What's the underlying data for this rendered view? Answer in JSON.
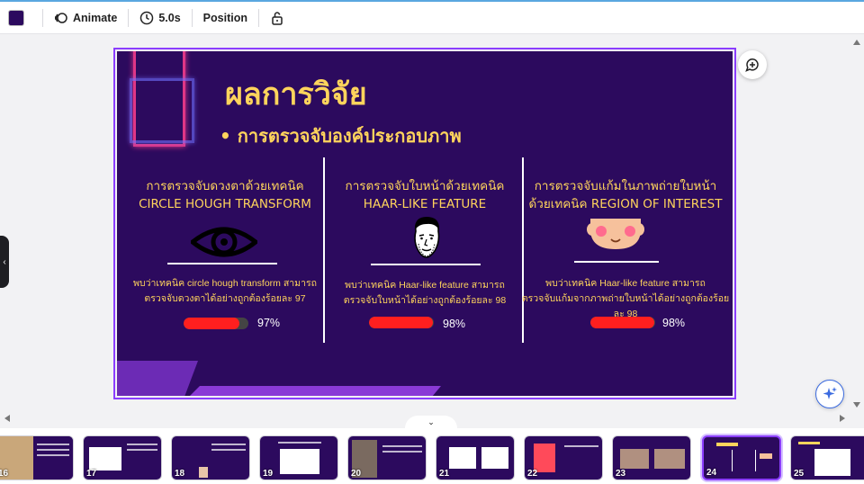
{
  "toolbar": {
    "color_swatch": "#2c0a5e",
    "animate_label": "Animate",
    "duration_label": "5.0s",
    "position_label": "Position"
  },
  "slide": {
    "title": "ผลการวิจัย",
    "subtitle": "• การตรวจจับองค์ประกอบภาพ",
    "colors": {
      "background": "#2c0a5e",
      "text": "#ffd45c",
      "bar": "#ff1f1f"
    },
    "columns": [
      {
        "heading_line1": "การตรวจจับดวงตาด้วยเทคนิค",
        "heading_line2": "CIRCLE HOUGH TRANSFORM",
        "icon": "eye-icon",
        "body_line1": "พบว่าเทคนิค circle hough transform สามารถ",
        "body_line2": "ตรวจจับดวงตาได้อย่างถูกต้องร้อยละ 97",
        "percent_label": "97%",
        "percent_value": 97
      },
      {
        "heading_line1": "การตรวจจับใบหน้าด้วยเทคนิค",
        "heading_line2": "HAAR-LIKE FEATURE",
        "icon": "face-sketch-icon",
        "body_line1": "พบว่าเทคนิค Haar-like feature สามารถ",
        "body_line2": "ตรวจจับใบหน้าได้อย่างถูกต้องร้อยละ 98",
        "percent_label": "98%",
        "percent_value": 98
      },
      {
        "heading_line1": "การตรวจจับแก้มในภาพถ่ายใบหน้า",
        "heading_line2": "ด้วยเทคนิค REGION OF INTEREST",
        "icon": "blushing-face-icon",
        "body_line1": "พบว่าเทคนิค Haar-like feature สามารถ",
        "body_line2": "ตรวจจับแก้มจากภาพถ่ายใบหน้าได้อย่างถูกต้องร้อยละ 98",
        "percent_label": "98%",
        "percent_value": 98
      }
    ]
  },
  "filmstrip": {
    "pages": [
      "16",
      "17",
      "18",
      "19",
      "20",
      "21",
      "22",
      "23",
      "24",
      "25"
    ],
    "active_page": "24"
  }
}
